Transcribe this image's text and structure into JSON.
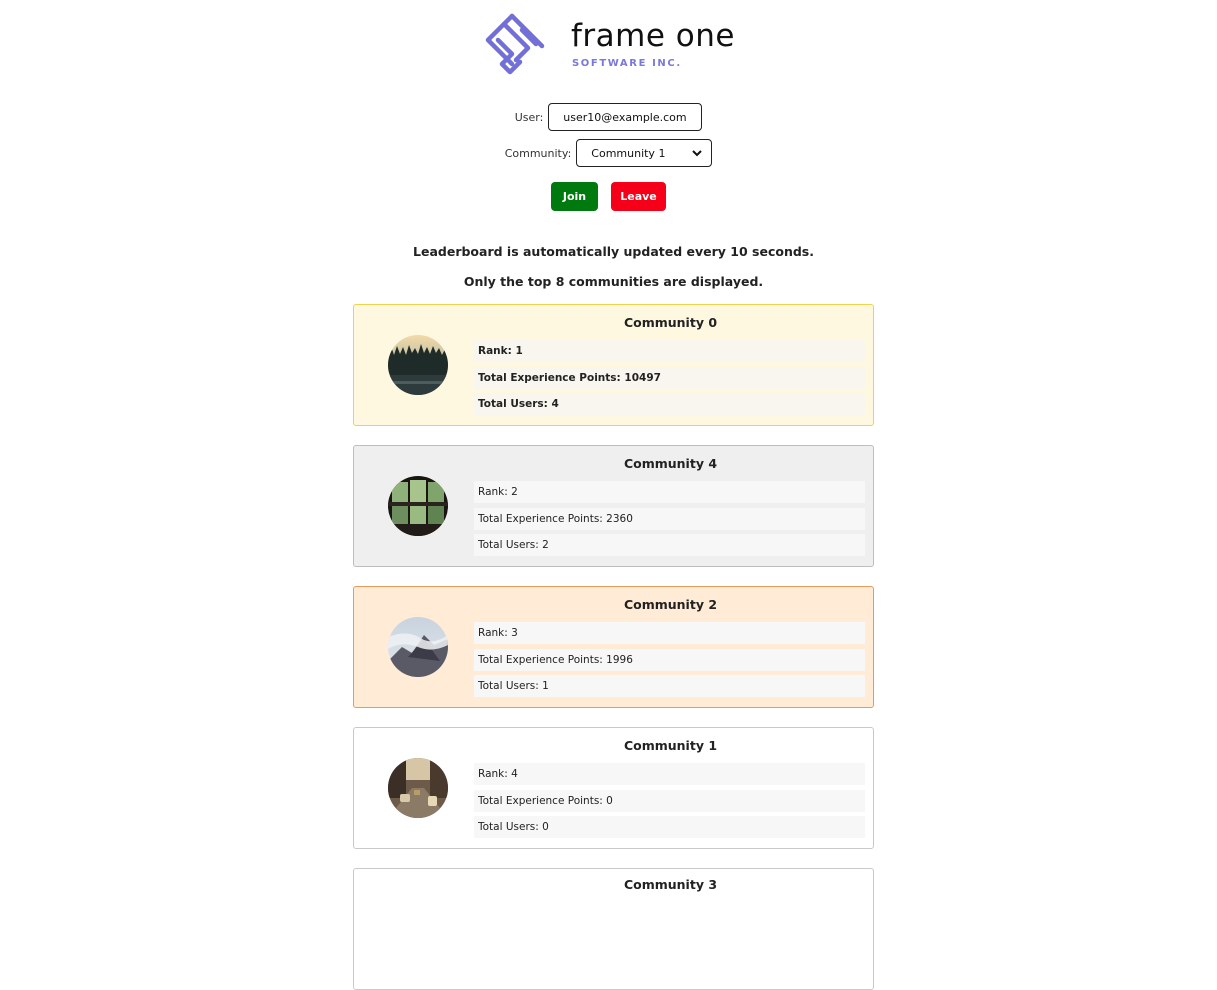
{
  "brand": {
    "name": "frame one",
    "tagline": "SOFTWARE INC.",
    "accent_color": "#6f6cd3"
  },
  "form": {
    "user_label": "User:",
    "user_value": "user10@example.com",
    "community_label": "Community:",
    "community_value": "Community 1"
  },
  "actions": {
    "join_label": "Join",
    "join_color": "#007a0e",
    "leave_label": "Leave",
    "leave_color": "#f60019"
  },
  "notices": {
    "update_interval": "Leaderboard is automatically updated every 10 seconds.",
    "top_limit": "Only the top 8 communities are displayed."
  },
  "leaderboard": [
    {
      "title": "Community 0",
      "rank": "Rank: 1",
      "points": "Total Experience Points: 10497",
      "users": "Total Users: 4",
      "tier": "gold",
      "image": "forest-treeline-image"
    },
    {
      "title": "Community 4",
      "rank": "Rank: 2",
      "points": "Total Experience Points: 2360",
      "users": "Total Users: 2",
      "tier": "silver",
      "image": "window-greenery-image"
    },
    {
      "title": "Community 2",
      "rank": "Rank: 3",
      "points": "Total Experience Points: 1996",
      "users": "Total Users: 1",
      "tier": "bronze",
      "image": "misty-mountain-image"
    },
    {
      "title": "Community 1",
      "rank": "Rank: 4",
      "points": "Total Experience Points: 0",
      "users": "Total Users: 0",
      "tier": "plain",
      "image": "city-street-image"
    },
    {
      "title": "Community 3",
      "tier": "plain"
    }
  ]
}
